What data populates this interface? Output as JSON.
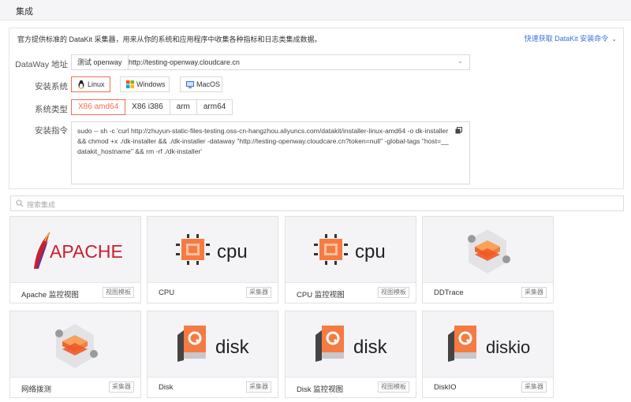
{
  "header": {
    "title": "集成"
  },
  "install": {
    "description": "官方提供标准的 DataKit 采集器，用来从你的系统和应用程序中收集各种指标和日志类集成数据。",
    "quick_link": "快速获取 DataKit 安装命令",
    "dataway_label": "DataWay 地址",
    "dataway_tag": "测试 openway",
    "dataway_url": "http://testing-openway.cloudcare.cn",
    "os_label": "安装系统",
    "os_options": [
      "Linux",
      "Windows",
      "MacOS"
    ],
    "os_selected": "Linux",
    "arch_label": "系统类型",
    "arch_options": [
      "X86 amd64",
      "X86 i386",
      "arm",
      "arm64"
    ],
    "arch_selected": "X86 amd64",
    "cmd_label": "安装指令",
    "command": "sudo -- sh -c 'curl http://zhuyun-static-files-testing.oss-cn-hangzhou.aliyuncs.com/datakit/installer-linux-amd64 -o dk-installer && chmod +x ./dk-installer && ./dk-installer -dataway \"http://testing-openway.cloudcare.cn?token=null\" -global-tags \"host=__datakit_hostname\" && rm -rf ./dk-installer'"
  },
  "search": {
    "placeholder": "搜索集成"
  },
  "cards": [
    {
      "name": "Apache 监控视图",
      "tag": "视图模板",
      "logo_text": "APACHE"
    },
    {
      "name": "CPU",
      "tag": "采集器",
      "logo_text": "cpu"
    },
    {
      "name": "CPU 监控视图",
      "tag": "视图模板",
      "logo_text": "cpu"
    },
    {
      "name": "DDTrace",
      "tag": "采集器",
      "logo_text": ""
    },
    {
      "name": "网络拨测",
      "tag": "采集器",
      "logo_text": ""
    },
    {
      "name": "Disk",
      "tag": "采集器",
      "logo_text": "disk"
    },
    {
      "name": "Disk 监控视图",
      "tag": "视图模板",
      "logo_text": "disk"
    },
    {
      "name": "DiskIO",
      "tag": "采集器",
      "logo_text": "diskio"
    }
  ],
  "colors": {
    "accent": "#f07050",
    "link": "#3a6fd8",
    "card_bg": "#f4f4f6"
  }
}
